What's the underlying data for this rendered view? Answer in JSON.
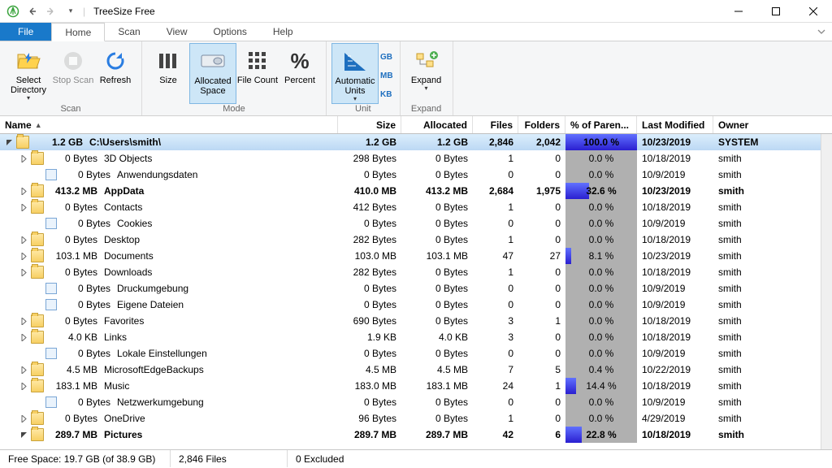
{
  "title": "TreeSize Free",
  "menu": {
    "file": "File",
    "home": "Home",
    "scan": "Scan",
    "view": "View",
    "options": "Options",
    "help": "Help"
  },
  "ribbon": {
    "select_directory": "Select Directory",
    "stop_scan": "Stop Scan",
    "refresh": "Refresh",
    "scan_group": "Scan",
    "size": "Size",
    "allocated_space": "Allocated Space",
    "file_count": "File Count",
    "percent": "Percent",
    "mode_group": "Mode",
    "automatic_units": "Automatic Units",
    "unit_gb": "GB",
    "unit_mb": "MB",
    "unit_kb": "KB",
    "unit_group": "Unit",
    "expand": "Expand",
    "expand_group": "Expand"
  },
  "columns": {
    "name": "Name",
    "size": "Size",
    "allocated": "Allocated",
    "files": "Files",
    "folders": "Folders",
    "pct": "% of Paren...",
    "modified": "Last Modified",
    "owner": "Owner"
  },
  "rows": [
    {
      "indent": 0,
      "exp": "open",
      "icon": "folder",
      "sizeLabel": "1.2 GB",
      "name": "C:\\Users\\smith\\",
      "size": "1.2 GB",
      "alloc": "1.2 GB",
      "files": "2,846",
      "folders": "2,042",
      "pct": 100.0,
      "pctText": "100.0 %",
      "mod": "10/23/2019",
      "owner": "SYSTEM",
      "sel": true,
      "bold": true,
      "heat": 100
    },
    {
      "indent": 1,
      "exp": "closed",
      "icon": "folder",
      "sizeLabel": "0 Bytes",
      "name": "3D Objects",
      "size": "298 Bytes",
      "alloc": "0 Bytes",
      "files": "1",
      "folders": "0",
      "pct": 0.0,
      "pctText": "0.0 %",
      "mod": "10/18/2019",
      "owner": "smith"
    },
    {
      "indent": 1,
      "exp": "none",
      "icon": "sys",
      "sizeLabel": "0 Bytes",
      "name": "Anwendungsdaten",
      "size": "0 Bytes",
      "alloc": "0 Bytes",
      "files": "0",
      "folders": "0",
      "pct": 0.0,
      "pctText": "0.0 %",
      "mod": "10/9/2019",
      "owner": "smith"
    },
    {
      "indent": 1,
      "exp": "closed",
      "icon": "folder",
      "sizeLabel": "413.2 MB",
      "name": "AppData",
      "size": "410.0 MB",
      "alloc": "413.2 MB",
      "files": "2,684",
      "folders": "1,975",
      "pct": 32.6,
      "pctText": "32.6 %",
      "mod": "10/23/2019",
      "owner": "smith",
      "bold": true,
      "heat": 33
    },
    {
      "indent": 1,
      "exp": "closed",
      "icon": "folder",
      "sizeLabel": "0 Bytes",
      "name": "Contacts",
      "size": "412 Bytes",
      "alloc": "0 Bytes",
      "files": "1",
      "folders": "0",
      "pct": 0.0,
      "pctText": "0.0 %",
      "mod": "10/18/2019",
      "owner": "smith"
    },
    {
      "indent": 1,
      "exp": "none",
      "icon": "sys",
      "sizeLabel": "0 Bytes",
      "name": "Cookies",
      "size": "0 Bytes",
      "alloc": "0 Bytes",
      "files": "0",
      "folders": "0",
      "pct": 0.0,
      "pctText": "0.0 %",
      "mod": "10/9/2019",
      "owner": "smith"
    },
    {
      "indent": 1,
      "exp": "closed",
      "icon": "folder",
      "sizeLabel": "0 Bytes",
      "name": "Desktop",
      "size": "282 Bytes",
      "alloc": "0 Bytes",
      "files": "1",
      "folders": "0",
      "pct": 0.0,
      "pctText": "0.0 %",
      "mod": "10/18/2019",
      "owner": "smith"
    },
    {
      "indent": 1,
      "exp": "closed",
      "icon": "folder",
      "sizeLabel": "103.1 MB",
      "name": "Documents",
      "size": "103.0 MB",
      "alloc": "103.1 MB",
      "files": "47",
      "folders": "27",
      "pct": 8.1,
      "pctText": "8.1 %",
      "mod": "10/23/2019",
      "owner": "smith",
      "heat": 8
    },
    {
      "indent": 1,
      "exp": "closed",
      "icon": "folder",
      "sizeLabel": "0 Bytes",
      "name": "Downloads",
      "size": "282 Bytes",
      "alloc": "0 Bytes",
      "files": "1",
      "folders": "0",
      "pct": 0.0,
      "pctText": "0.0 %",
      "mod": "10/18/2019",
      "owner": "smith"
    },
    {
      "indent": 1,
      "exp": "none",
      "icon": "sys",
      "sizeLabel": "0 Bytes",
      "name": "Druckumgebung",
      "size": "0 Bytes",
      "alloc": "0 Bytes",
      "files": "0",
      "folders": "0",
      "pct": 0.0,
      "pctText": "0.0 %",
      "mod": "10/9/2019",
      "owner": "smith"
    },
    {
      "indent": 1,
      "exp": "none",
      "icon": "sys",
      "sizeLabel": "0 Bytes",
      "name": "Eigene Dateien",
      "size": "0 Bytes",
      "alloc": "0 Bytes",
      "files": "0",
      "folders": "0",
      "pct": 0.0,
      "pctText": "0.0 %",
      "mod": "10/9/2019",
      "owner": "smith"
    },
    {
      "indent": 1,
      "exp": "closed",
      "icon": "folder",
      "sizeLabel": "0 Bytes",
      "name": "Favorites",
      "size": "690 Bytes",
      "alloc": "0 Bytes",
      "files": "3",
      "folders": "1",
      "pct": 0.0,
      "pctText": "0.0 %",
      "mod": "10/18/2019",
      "owner": "smith"
    },
    {
      "indent": 1,
      "exp": "closed",
      "icon": "folder",
      "sizeLabel": "4.0 KB",
      "name": "Links",
      "size": "1.9 KB",
      "alloc": "4.0 KB",
      "files": "3",
      "folders": "0",
      "pct": 0.0,
      "pctText": "0.0 %",
      "mod": "10/18/2019",
      "owner": "smith"
    },
    {
      "indent": 1,
      "exp": "none",
      "icon": "sys",
      "sizeLabel": "0 Bytes",
      "name": "Lokale Einstellungen",
      "size": "0 Bytes",
      "alloc": "0 Bytes",
      "files": "0",
      "folders": "0",
      "pct": 0.0,
      "pctText": "0.0 %",
      "mod": "10/9/2019",
      "owner": "smith"
    },
    {
      "indent": 1,
      "exp": "closed",
      "icon": "folder",
      "sizeLabel": "4.5 MB",
      "name": "MicrosoftEdgeBackups",
      "size": "4.5 MB",
      "alloc": "4.5 MB",
      "files": "7",
      "folders": "5",
      "pct": 0.4,
      "pctText": "0.4 %",
      "mod": "10/22/2019",
      "owner": "smith"
    },
    {
      "indent": 1,
      "exp": "closed",
      "icon": "folder",
      "sizeLabel": "183.1 MB",
      "name": "Music",
      "size": "183.0 MB",
      "alloc": "183.1 MB",
      "files": "24",
      "folders": "1",
      "pct": 14.4,
      "pctText": "14.4 %",
      "mod": "10/18/2019",
      "owner": "smith",
      "heat": 14
    },
    {
      "indent": 1,
      "exp": "none",
      "icon": "sys",
      "sizeLabel": "0 Bytes",
      "name": "Netzwerkumgebung",
      "size": "0 Bytes",
      "alloc": "0 Bytes",
      "files": "0",
      "folders": "0",
      "pct": 0.0,
      "pctText": "0.0 %",
      "mod": "10/9/2019",
      "owner": "smith"
    },
    {
      "indent": 1,
      "exp": "closed",
      "icon": "folder",
      "sizeLabel": "0 Bytes",
      "name": "OneDrive",
      "size": "96 Bytes",
      "alloc": "0 Bytes",
      "files": "1",
      "folders": "0",
      "pct": 0.0,
      "pctText": "0.0 %",
      "mod": "4/29/2019",
      "owner": "smith"
    },
    {
      "indent": 1,
      "exp": "open",
      "icon": "folder",
      "sizeLabel": "289.7 MB",
      "name": "Pictures",
      "size": "289.7 MB",
      "alloc": "289.7 MB",
      "files": "42",
      "folders": "6",
      "pct": 22.8,
      "pctText": "22.8 %",
      "mod": "10/18/2019",
      "owner": "smith",
      "bold": true,
      "heat": 23
    }
  ],
  "status": {
    "free": "Free Space: 19.7 GB  (of 38.9 GB)",
    "files": "2,846 Files",
    "excluded": "0 Excluded"
  }
}
